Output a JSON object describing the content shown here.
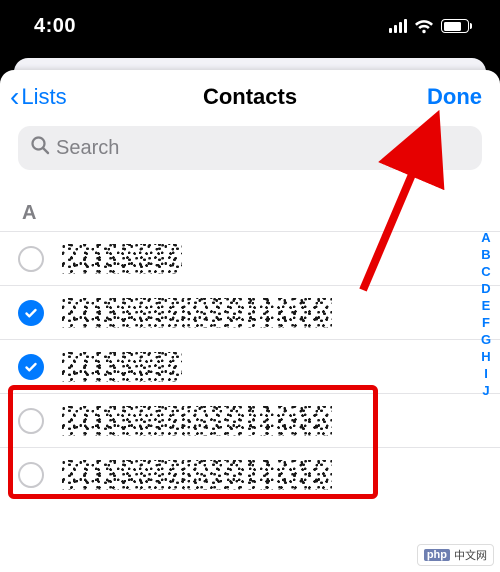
{
  "status": {
    "time": "4:00"
  },
  "nav": {
    "back_label": "Lists",
    "title": "Contacts",
    "done_label": "Done"
  },
  "search": {
    "placeholder": "Search"
  },
  "section": {
    "header": "A"
  },
  "contacts": [
    {
      "selected": false
    },
    {
      "selected": true
    },
    {
      "selected": true
    },
    {
      "selected": false
    },
    {
      "selected": false
    }
  ],
  "index": [
    "A",
    "B",
    "C",
    "D",
    "E",
    "F",
    "G",
    "H",
    "I",
    "J"
  ],
  "watermark": {
    "prefix": "php",
    "text": "中文网"
  },
  "colors": {
    "accent": "#007aff",
    "annotation": "#e60000"
  }
}
